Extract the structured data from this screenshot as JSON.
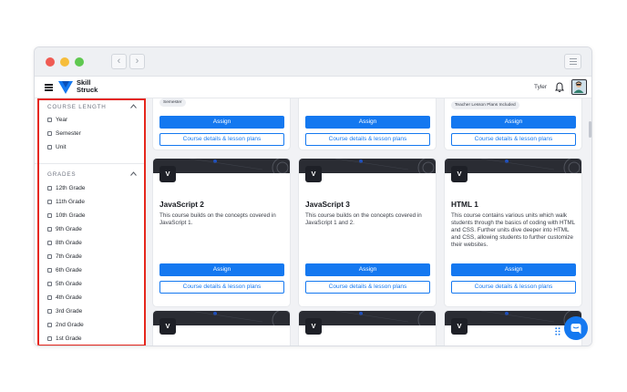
{
  "window": {
    "back_glyph": "‹",
    "forward_glyph": "›"
  },
  "appbar": {
    "logo_line1": "Skill",
    "logo_line2": "Struck",
    "user_name": "Tyler"
  },
  "sidebar": {
    "course_length": {
      "title": "COURSE LENGTH",
      "options": [
        "Year",
        "Semester",
        "Unit"
      ]
    },
    "grades": {
      "title": "GRADES",
      "options": [
        "12th Grade",
        "11th Grade",
        "10th Grade",
        "9th Grade",
        "8th Grade",
        "7th Grade",
        "6th Grade",
        "5th Grade",
        "4th Grade",
        "3rd Grade",
        "2nd Grade",
        "1st Grade"
      ]
    }
  },
  "courses": {
    "top_row": {
      "tag_left": "Semester",
      "tag_right": "Teacher Lesson Plans Included",
      "assign_label": "Assign",
      "details_label": "Course details & lesson plans"
    },
    "cards": [
      {
        "badge": "V",
        "title": "JavaScript 2",
        "description": "This course builds on the concepts covered in JavaScript 1.",
        "assign_label": "Assign",
        "details_label": "Course details & lesson plans"
      },
      {
        "badge": "V",
        "title": "JavaScript 3",
        "description": "This course builds on the concepts covered in JavaScript 1 and 2.",
        "assign_label": "Assign",
        "details_label": "Course details & lesson plans"
      },
      {
        "badge": "V",
        "title": "HTML 1",
        "description": "This course contains various units which walk students through the basics of coding with HTML and CSS. Further units dive deeper into HTML and CSS, allowing students to further customize their websites.",
        "assign_label": "Assign",
        "details_label": "Course details & lesson plans"
      }
    ],
    "bottom_badges": [
      "V",
      "V",
      "V"
    ]
  },
  "colors": {
    "accent": "#1478f0",
    "highlight_border": "#e5271d",
    "banner_dark": "#2a2c33"
  },
  "icons": [
    "menu-icon",
    "bell-icon",
    "chevron-up-icon",
    "chat-icon",
    "grid-icon"
  ]
}
